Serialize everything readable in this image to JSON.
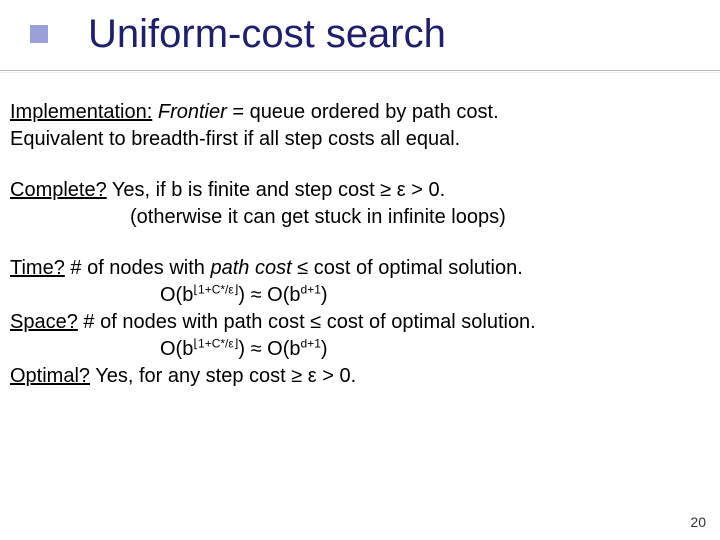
{
  "slide": {
    "title": "Uniform-cost search",
    "page_number": "20",
    "impl_label": "Implementation:",
    "impl_frontier_word": "Frontier",
    "impl_rest1": " = queue ordered by path cost.",
    "impl_line2": "Equivalent to breadth-first if all step costs all equal.",
    "complete_label": "Complete?",
    "complete_rest": " Yes, if b is finite and step cost ≥ ε > 0.",
    "complete_line2": "(otherwise it can get stuck in infinite loops)",
    "time_label": "Time?",
    "time_pre": " # of nodes with ",
    "time_pathcost": "path cost",
    "time_post": " ≤ cost of optimal solution.",
    "time_formula_pre": "O(b",
    "time_exp1": "⌊1+C*/ε⌋",
    "time_formula_mid": ") ≈ O(b",
    "time_exp2": "d+1",
    "time_formula_end": ")",
    "space_label": "Space?",
    "space_rest": " # of nodes with path cost ≤ cost of optimal solution.",
    "space_formula_pre": "O(b",
    "space_exp1": "⌊1+C*/ε⌋",
    "space_formula_mid": ") ≈ O(b",
    "space_exp2": "d+1",
    "space_formula_end": ")",
    "optimal_label": "Optimal?",
    "optimal_rest": " Yes, for any step cost ≥ ε > 0."
  }
}
